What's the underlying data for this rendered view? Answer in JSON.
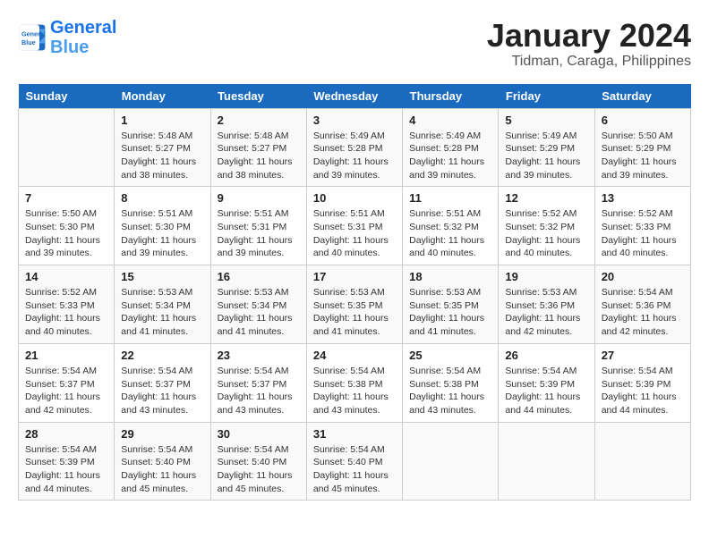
{
  "logo": {
    "line1": "General",
    "line2": "Blue"
  },
  "title": "January 2024",
  "subtitle": "Tidman, Caraga, Philippines",
  "days_of_week": [
    "Sunday",
    "Monday",
    "Tuesday",
    "Wednesday",
    "Thursday",
    "Friday",
    "Saturday"
  ],
  "weeks": [
    [
      {
        "day": "",
        "info": ""
      },
      {
        "day": "1",
        "info": "Sunrise: 5:48 AM\nSunset: 5:27 PM\nDaylight: 11 hours\nand 38 minutes."
      },
      {
        "day": "2",
        "info": "Sunrise: 5:48 AM\nSunset: 5:27 PM\nDaylight: 11 hours\nand 38 minutes."
      },
      {
        "day": "3",
        "info": "Sunrise: 5:49 AM\nSunset: 5:28 PM\nDaylight: 11 hours\nand 39 minutes."
      },
      {
        "day": "4",
        "info": "Sunrise: 5:49 AM\nSunset: 5:28 PM\nDaylight: 11 hours\nand 39 minutes."
      },
      {
        "day": "5",
        "info": "Sunrise: 5:49 AM\nSunset: 5:29 PM\nDaylight: 11 hours\nand 39 minutes."
      },
      {
        "day": "6",
        "info": "Sunrise: 5:50 AM\nSunset: 5:29 PM\nDaylight: 11 hours\nand 39 minutes."
      }
    ],
    [
      {
        "day": "7",
        "info": "Sunrise: 5:50 AM\nSunset: 5:30 PM\nDaylight: 11 hours\nand 39 minutes."
      },
      {
        "day": "8",
        "info": "Sunrise: 5:51 AM\nSunset: 5:30 PM\nDaylight: 11 hours\nand 39 minutes."
      },
      {
        "day": "9",
        "info": "Sunrise: 5:51 AM\nSunset: 5:31 PM\nDaylight: 11 hours\nand 39 minutes."
      },
      {
        "day": "10",
        "info": "Sunrise: 5:51 AM\nSunset: 5:31 PM\nDaylight: 11 hours\nand 40 minutes."
      },
      {
        "day": "11",
        "info": "Sunrise: 5:51 AM\nSunset: 5:32 PM\nDaylight: 11 hours\nand 40 minutes."
      },
      {
        "day": "12",
        "info": "Sunrise: 5:52 AM\nSunset: 5:32 PM\nDaylight: 11 hours\nand 40 minutes."
      },
      {
        "day": "13",
        "info": "Sunrise: 5:52 AM\nSunset: 5:33 PM\nDaylight: 11 hours\nand 40 minutes."
      }
    ],
    [
      {
        "day": "14",
        "info": "Sunrise: 5:52 AM\nSunset: 5:33 PM\nDaylight: 11 hours\nand 40 minutes."
      },
      {
        "day": "15",
        "info": "Sunrise: 5:53 AM\nSunset: 5:34 PM\nDaylight: 11 hours\nand 41 minutes."
      },
      {
        "day": "16",
        "info": "Sunrise: 5:53 AM\nSunset: 5:34 PM\nDaylight: 11 hours\nand 41 minutes."
      },
      {
        "day": "17",
        "info": "Sunrise: 5:53 AM\nSunset: 5:35 PM\nDaylight: 11 hours\nand 41 minutes."
      },
      {
        "day": "18",
        "info": "Sunrise: 5:53 AM\nSunset: 5:35 PM\nDaylight: 11 hours\nand 41 minutes."
      },
      {
        "day": "19",
        "info": "Sunrise: 5:53 AM\nSunset: 5:36 PM\nDaylight: 11 hours\nand 42 minutes."
      },
      {
        "day": "20",
        "info": "Sunrise: 5:54 AM\nSunset: 5:36 PM\nDaylight: 11 hours\nand 42 minutes."
      }
    ],
    [
      {
        "day": "21",
        "info": "Sunrise: 5:54 AM\nSunset: 5:37 PM\nDaylight: 11 hours\nand 42 minutes."
      },
      {
        "day": "22",
        "info": "Sunrise: 5:54 AM\nSunset: 5:37 PM\nDaylight: 11 hours\nand 43 minutes."
      },
      {
        "day": "23",
        "info": "Sunrise: 5:54 AM\nSunset: 5:37 PM\nDaylight: 11 hours\nand 43 minutes."
      },
      {
        "day": "24",
        "info": "Sunrise: 5:54 AM\nSunset: 5:38 PM\nDaylight: 11 hours\nand 43 minutes."
      },
      {
        "day": "25",
        "info": "Sunrise: 5:54 AM\nSunset: 5:38 PM\nDaylight: 11 hours\nand 43 minutes."
      },
      {
        "day": "26",
        "info": "Sunrise: 5:54 AM\nSunset: 5:39 PM\nDaylight: 11 hours\nand 44 minutes."
      },
      {
        "day": "27",
        "info": "Sunrise: 5:54 AM\nSunset: 5:39 PM\nDaylight: 11 hours\nand 44 minutes."
      }
    ],
    [
      {
        "day": "28",
        "info": "Sunrise: 5:54 AM\nSunset: 5:39 PM\nDaylight: 11 hours\nand 44 minutes."
      },
      {
        "day": "29",
        "info": "Sunrise: 5:54 AM\nSunset: 5:40 PM\nDaylight: 11 hours\nand 45 minutes."
      },
      {
        "day": "30",
        "info": "Sunrise: 5:54 AM\nSunset: 5:40 PM\nDaylight: 11 hours\nand 45 minutes."
      },
      {
        "day": "31",
        "info": "Sunrise: 5:54 AM\nSunset: 5:40 PM\nDaylight: 11 hours\nand 45 minutes."
      },
      {
        "day": "",
        "info": ""
      },
      {
        "day": "",
        "info": ""
      },
      {
        "day": "",
        "info": ""
      }
    ]
  ]
}
